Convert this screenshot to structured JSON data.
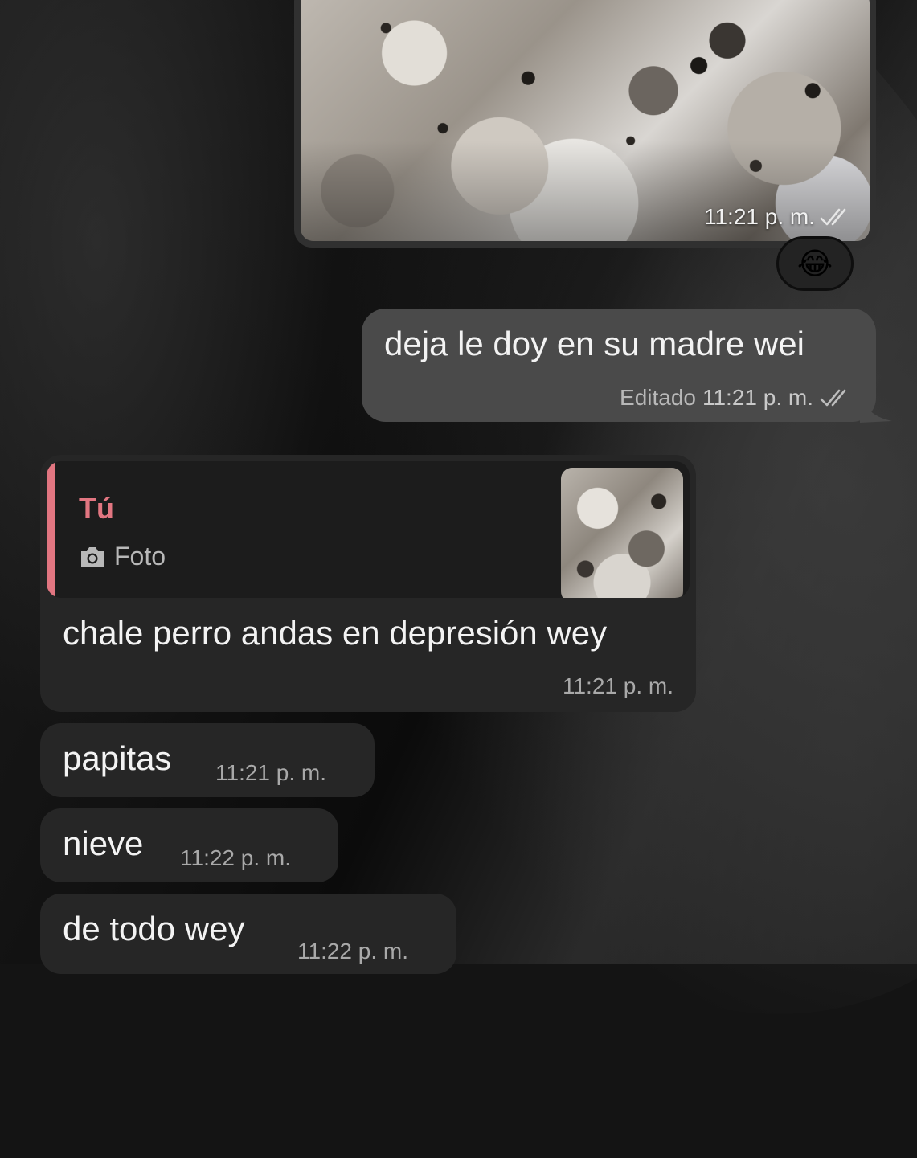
{
  "messages": {
    "photo_out": {
      "time": "11:21 p. m.",
      "status_icon": "double-check-icon"
    },
    "reaction": {
      "emoji": "😂"
    },
    "text_out": {
      "text": "deja le doy en su madre wei",
      "edited_label": "Editado",
      "time": "11:21 p. m."
    },
    "reply_in": {
      "quote_author": "Tú",
      "quote_kind": "Foto",
      "quote_icon": "camera-icon",
      "text": "chale perro andas en depresión wey",
      "time": "11:21 p. m."
    },
    "in_1": {
      "text": "papitas",
      "time": "11:21 p. m."
    },
    "in_2": {
      "text": "nieve",
      "time": "11:22 p. m."
    },
    "in_3": {
      "text": "de todo wey",
      "time": "11:22 p. m."
    }
  },
  "colors": {
    "quote_accent": "#e27681",
    "outgoing_bubble": "#4a4a4a",
    "incoming_bubble": "#262626"
  }
}
